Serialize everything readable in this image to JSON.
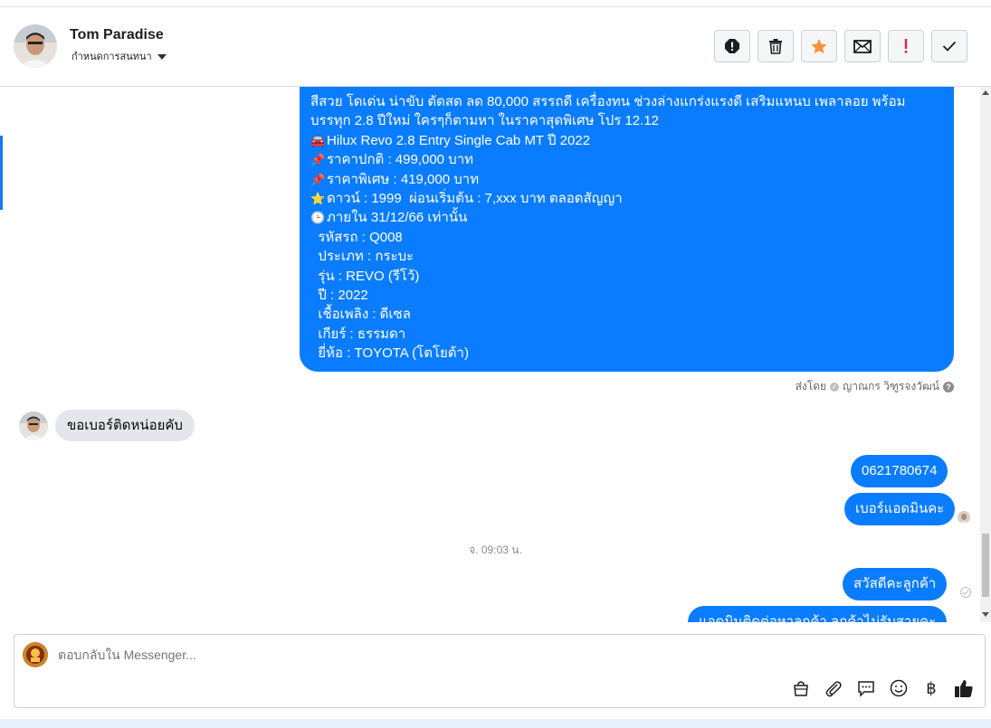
{
  "header": {
    "contact_name": "Tom Paradise",
    "assign_label": "กำหนดการสนทนา",
    "actions": [
      {
        "name": "report-spam-icon",
        "color": "#1c1e21"
      },
      {
        "name": "trash-icon",
        "color": "#1c1e21"
      },
      {
        "name": "star-icon",
        "color": "#f7923a"
      },
      {
        "name": "envelope-icon",
        "color": "#1c1e21"
      },
      {
        "name": "exclamation-icon",
        "color": "#e41e3f"
      },
      {
        "name": "checkmark-icon",
        "color": "#1c1e21"
      }
    ]
  },
  "conversation": {
    "listing_message": {
      "lines": [
        {
          "icon": "",
          "text": "สีสวย โดเด่น น่าขับ ตัดสด ลด 80,000 สรรถดี เครื่องทน ช่วงล่างแกร่งแรงดี เสริมแหนบ เพลาลอย พร้อม"
        },
        {
          "icon": "",
          "text": "บรรทุก 2.8 ปีใหม่ ใครๆก็ตามหา ในราคาสุดพิเศษ โปร 12.12"
        },
        {
          "icon": "🚘",
          "text": "Hilux Revo 2.8 Entry Single Cab MT ปี 2022"
        },
        {
          "icon": "📌",
          "text": "ราคาปกติ : 499,000 บาท"
        },
        {
          "icon": "📌",
          "text": "ราคาพิเศษ : 419,000 บาท"
        },
        {
          "icon": "⭐",
          "text": "ดาวน์ : 1999  ผ่อนเริ่มต้น : 7,xxx บาท ตลอดสัญญา"
        },
        {
          "icon": "🕒",
          "text": "ภายใน 31/12/66 เท่านั้น"
        },
        {
          "icon": "",
          "text": "  รหัสรถ : Q008"
        },
        {
          "icon": "",
          "text": "  ประเภท : กระบะ"
        },
        {
          "icon": "",
          "text": "  รุ่น : REVO (รีโว้)"
        },
        {
          "icon": "",
          "text": "  ปี : 2022"
        },
        {
          "icon": "",
          "text": "  เชื้อเพลิง : ดีเซล"
        },
        {
          "icon": "",
          "text": "  เกียร์ : ธรรมดา"
        },
        {
          "icon": "",
          "text": "  ยี่ห้อ : TOYOTA (โตโยต้า)"
        }
      ],
      "sent_by_prefix": "ส่งโดย",
      "sent_by_name": "ญาณกร วิฑูรจงวัฒน์",
      "help_glyph": "?"
    },
    "incoming_message": "ขอเบอร์ติดหน่อยคับ",
    "outgoing_phone": "0621780674",
    "outgoing_admin": "เบอร์แอดมินคะ",
    "timestamp": "จ. 09:03 น.",
    "outgoing_greeting": "สวัสดีคะลูกค้า",
    "outgoing_partial": "แอดมินติดต่อหาลูกค้า ลูกค้าไม่รับสายคะ"
  },
  "composer": {
    "placeholder": "ตอบกลับใน Messenger...",
    "tools": [
      "bag-icon",
      "paperclip-icon",
      "chat-bubble-icon",
      "emoji-icon",
      "baht-icon",
      "thumbs-up-icon"
    ],
    "baht_glyph": "฿"
  },
  "colors": {
    "brand_blue": "#0a7cff",
    "accent_blue": "#1877f2",
    "incoming_bg": "#e4e6eb"
  }
}
